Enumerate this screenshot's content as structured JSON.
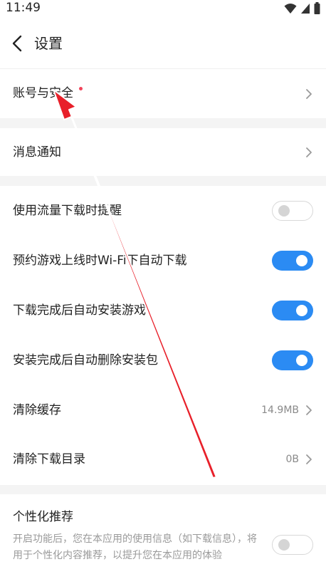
{
  "status_bar": {
    "time": "11:49"
  },
  "header": {
    "title": "设置"
  },
  "rows": {
    "account": {
      "label": "账号与安全"
    },
    "notifications": {
      "label": "消息通知"
    },
    "mobile_download_alert": {
      "label": "使用流量下载时提醒",
      "enabled": false
    },
    "reserved_game_wifi_download": {
      "label": "预约游戏上线时Wi-Fi下自动下载",
      "enabled": true
    },
    "auto_install": {
      "label": "下载完成后自动安装游戏",
      "enabled": true
    },
    "auto_delete_package": {
      "label": "安装完成后自动删除安装包",
      "enabled": true
    },
    "clear_cache": {
      "label": "清除缓存",
      "value": "14.9MB"
    },
    "clear_download_dir": {
      "label": "清除下载目录",
      "value": "0B"
    },
    "personalized": {
      "label": "个性化推荐",
      "description": "开启功能后，您在本应用的使用信息（如下载信息），将用于个性化内容推荐，以提升您在本应用的体验",
      "enabled": false
    }
  },
  "colors": {
    "accent": "#2b8bf3",
    "badge": "#f2435a",
    "annotation_arrow": "#e8202a"
  },
  "icons": [
    "back-arrow-icon",
    "chevron-right-icon",
    "wifi-icon",
    "signal-icon",
    "battery-icon"
  ]
}
